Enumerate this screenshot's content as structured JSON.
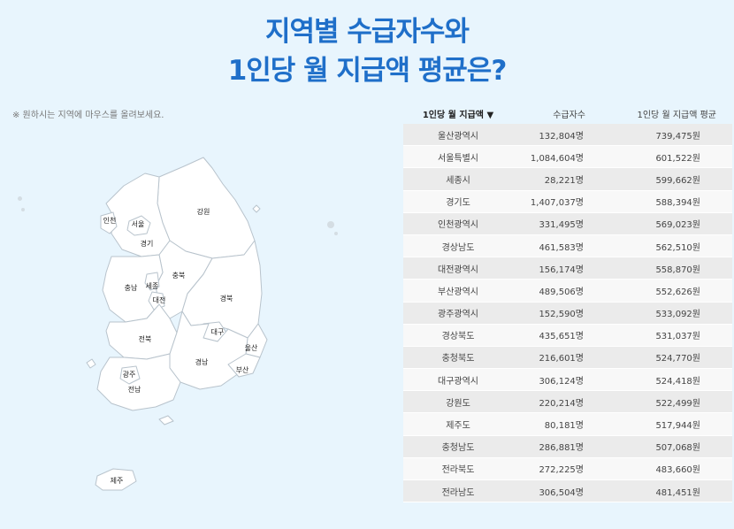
{
  "title": {
    "line1": "지역별 수급자수와",
    "line2": "1인당 월 지급액 평균은?"
  },
  "hint": "※ 원하시는 지역에 마우스를 올려보세요.",
  "table": {
    "headers": {
      "region": "1인당 월 지급액 ▼",
      "count": "수급자수",
      "avg": "1인당 월 지급액 평균"
    },
    "rows": [
      {
        "region": "울산광역시",
        "count": "132,804명",
        "avg": "739,475원"
      },
      {
        "region": "서울특별시",
        "count": "1,084,604명",
        "avg": "601,522원"
      },
      {
        "region": "세종시",
        "count": "28,221명",
        "avg": "599,662원"
      },
      {
        "region": "경기도",
        "count": "1,407,037명",
        "avg": "588,394원"
      },
      {
        "region": "인천광역시",
        "count": "331,495명",
        "avg": "569,023원"
      },
      {
        "region": "경상남도",
        "count": "461,583명",
        "avg": "562,510원"
      },
      {
        "region": "대전광역시",
        "count": "156,174명",
        "avg": "558,870원"
      },
      {
        "region": "부산광역시",
        "count": "489,506명",
        "avg": "552,626원"
      },
      {
        "region": "광주광역시",
        "count": "152,590명",
        "avg": "533,092원"
      },
      {
        "region": "경상북도",
        "count": "435,651명",
        "avg": "531,037원"
      },
      {
        "region": "충청북도",
        "count": "216,601명",
        "avg": "524,770원"
      },
      {
        "region": "대구광역시",
        "count": "306,124명",
        "avg": "524,418원"
      },
      {
        "region": "강원도",
        "count": "220,214명",
        "avg": "522,499원"
      },
      {
        "region": "제주도",
        "count": "80,181명",
        "avg": "517,944원"
      },
      {
        "region": "충청남도",
        "count": "286,881명",
        "avg": "507,068원"
      },
      {
        "region": "전라북도",
        "count": "272,225명",
        "avg": "483,660원"
      },
      {
        "region": "전라남도",
        "count": "306,504명",
        "avg": "481,451원"
      }
    ]
  },
  "map": {
    "labels": {
      "incheon": "인천",
      "seoul": "서울",
      "gyeonggi": "경기",
      "gangwon": "강원",
      "chungbuk": "충북",
      "chungnam": "충남",
      "sejong": "세종",
      "daejeon": "대전",
      "gyeongbuk": "경북",
      "jeonbuk": "전북",
      "daegu": "대구",
      "ulsan": "울산",
      "gyeongnam": "경남",
      "busan": "부산",
      "gwangju": "광주",
      "jeonnam": "전남",
      "jeju": "제주"
    },
    "colors": {
      "fill": "#ffffff",
      "stroke": "#b8c3cc"
    }
  }
}
